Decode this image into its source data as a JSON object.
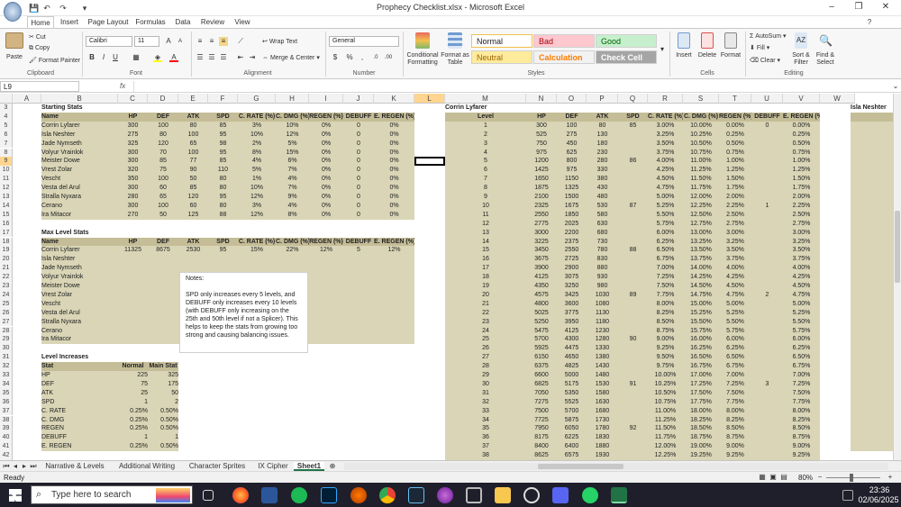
{
  "window": {
    "title": "Prophecy Checklist.xlsx - Microsoft Excel",
    "controls": [
      "–",
      "❐",
      "✕"
    ]
  },
  "ribbon_tabs": [
    "Home",
    "Insert",
    "Page Layout",
    "Formulas",
    "Data",
    "Review",
    "View"
  ],
  "ribbon": {
    "clipboard": {
      "paste": "Paste",
      "cut": "Cut",
      "copy": "Copy",
      "painter": "Format Painter",
      "label": "Clipboard"
    },
    "font": {
      "name": "Calibri",
      "size": "11",
      "label": "Font"
    },
    "alignment": {
      "wrap": "Wrap Text",
      "merge": "Merge & Center",
      "label": "Alignment"
    },
    "number": {
      "format": "General",
      "label": "Number"
    },
    "styles": {
      "cond": "Conditional Formatting",
      "fmt_table": "Format as Table",
      "normal": "Normal",
      "bad": "Bad",
      "good": "Good",
      "neutral": "Neutral",
      "calculation": "Calculation",
      "check": "Check Cell",
      "label": "Styles"
    },
    "cells": {
      "insert": "Insert",
      "delete": "Delete",
      "format": "Format",
      "label": "Cells"
    },
    "editing": {
      "autosum": "AutoSum",
      "fill": "Fill",
      "clear": "Clear",
      "sort": "Sort & Filter",
      "find": "Find & Select",
      "label": "Editing"
    }
  },
  "formula_bar": {
    "name_box": "L9",
    "fx": "fx",
    "value": ""
  },
  "columns": [
    "A",
    "B",
    "C",
    "D",
    "E",
    "F",
    "G",
    "H",
    "I",
    "J",
    "K",
    "L",
    "M",
    "N",
    "O",
    "P",
    "Q",
    "R",
    "S",
    "T",
    "U",
    "V",
    "W"
  ],
  "rows": [
    "3",
    "4",
    "5",
    "6",
    "7",
    "8",
    "9",
    "10",
    "11",
    "12",
    "13",
    "14",
    "15",
    "16",
    "17",
    "18",
    "19",
    "20",
    "21",
    "22",
    "23",
    "24",
    "25",
    "26",
    "27",
    "28",
    "29",
    "30",
    "31",
    "32",
    "33",
    "34",
    "35",
    "36",
    "37",
    "38",
    "39",
    "40",
    "41",
    "42"
  ],
  "starting": {
    "title": "Starting Stats",
    "headers": [
      "Name",
      "HP",
      "DEF",
      "ATK",
      "SPD",
      "C. RATE (%)",
      "C. DMG (%)",
      "REGEN (%)",
      "DEBUFF",
      "E. REGEN (%)"
    ],
    "rows": [
      [
        "Corrin Lyfarer",
        "300",
        "100",
        "80",
        "85",
        "3%",
        "10%",
        "0%",
        "0",
        "0%"
      ],
      [
        "Isla Neshter",
        "275",
        "80",
        "100",
        "95",
        "10%",
        "12%",
        "0%",
        "0",
        "0%"
      ],
      [
        "Jade Nymseth",
        "325",
        "120",
        "65",
        "98",
        "2%",
        "5%",
        "0%",
        "0",
        "0%"
      ],
      [
        "Volyur Vrainlok",
        "300",
        "70",
        "100",
        "95",
        "8%",
        "15%",
        "0%",
        "0",
        "0%"
      ],
      [
        "Meister Dowe",
        "300",
        "85",
        "77",
        "85",
        "4%",
        "6%",
        "0%",
        "0",
        "0%"
      ],
      [
        "Vrest Zolar",
        "320",
        "75",
        "90",
        "110",
        "5%",
        "7%",
        "0%",
        "0",
        "0%"
      ],
      [
        "Vescht",
        "350",
        "100",
        "50",
        "80",
        "1%",
        "4%",
        "0%",
        "0",
        "0%"
      ],
      [
        "Vesta del Arul",
        "300",
        "60",
        "85",
        "80",
        "10%",
        "7%",
        "0%",
        "0",
        "0%"
      ],
      [
        "Stralla Nyxara",
        "280",
        "65",
        "120",
        "95",
        "12%",
        "9%",
        "0%",
        "0",
        "0%"
      ],
      [
        "Cerano",
        "300",
        "100",
        "60",
        "80",
        "3%",
        "4%",
        "0%",
        "0",
        "0%"
      ],
      [
        "Ira Mitacor",
        "270",
        "50",
        "125",
        "88",
        "12%",
        "8%",
        "0%",
        "0",
        "0%"
      ]
    ]
  },
  "max": {
    "title": "Max Level Stats",
    "headers": [
      "Name",
      "HP",
      "DEF",
      "ATK",
      "SPD",
      "C. RATE (%)",
      "C. DMG (%)",
      "REGEN (%)",
      "DEBUFF",
      "E. REGEN (%)"
    ],
    "rows": [
      [
        "Corrin Lyfarer",
        "11325",
        "8675",
        "2530",
        "95",
        "15%",
        "22%",
        "12%",
        "5",
        "12%"
      ],
      [
        "Isla Neshter",
        "",
        "",
        "",
        "",
        "",
        "",
        "",
        "",
        ""
      ],
      [
        "Jade Nymseth",
        "",
        "",
        "",
        "",
        "",
        "",
        "",
        "",
        ""
      ],
      [
        "Volyur Vrainlok",
        "",
        "",
        "",
        "",
        "",
        "",
        "",
        "",
        ""
      ],
      [
        "Meister Dowe",
        "",
        "",
        "",
        "",
        "",
        "",
        "",
        "",
        ""
      ],
      [
        "Vrest Zolar",
        "",
        "",
        "",
        "",
        "",
        "",
        "",
        "",
        ""
      ],
      [
        "Vescht",
        "",
        "",
        "",
        "",
        "",
        "",
        "",
        "",
        ""
      ],
      [
        "Vesta del Arul",
        "",
        "",
        "",
        "",
        "",
        "",
        "",
        "",
        ""
      ],
      [
        "Stralla Nyxara",
        "",
        "",
        "",
        "",
        "",
        "",
        "",
        "",
        ""
      ],
      [
        "Cerano",
        "",
        "",
        "",
        "",
        "",
        "",
        "",
        "",
        ""
      ],
      [
        "Ira Mitacor",
        "",
        "",
        "",
        "",
        "",
        "",
        "",
        "",
        ""
      ]
    ]
  },
  "increases": {
    "title": "Level Increases",
    "headers": [
      "Stat",
      "Normal",
      "Main Stat"
    ],
    "rows": [
      [
        "HP",
        "225",
        "325"
      ],
      [
        "DEF",
        "75",
        "175"
      ],
      [
        "ATK",
        "25",
        "50"
      ],
      [
        "SPD",
        "1",
        "2"
      ],
      [
        "C. RATE",
        "0.25%",
        "0.50%"
      ],
      [
        "C. DMG",
        "0.25%",
        "0.50%"
      ],
      [
        "REGEN",
        "0.25%",
        "0.50%"
      ],
      [
        "DEBUFF",
        "1",
        "1"
      ],
      [
        "E. REGEN",
        "0.25%",
        "0.50%"
      ]
    ]
  },
  "note": "Notes:\n\nSPD only increases every 5 levels, and DEBUFF only increases every 10 levels (with DEBUFF only increasing on the 25th and 50th level if not a Splicer). This helps to keep the stats from growing too strong and causing balancing issues.",
  "corrin": {
    "title": "Corrin Lyfarer",
    "headers": [
      "Level",
      "HP",
      "DEF",
      "ATK",
      "SPD",
      "C. RATE (%)",
      "C. DMG (%)",
      "REGEN (%)",
      "DEBUFF",
      "E. REGEN (%)"
    ],
    "rows": [
      [
        "1",
        "300",
        "100",
        "80",
        "85",
        "3.00%",
        "10.00%",
        "0.00%",
        "0",
        "0.00%"
      ],
      [
        "2",
        "525",
        "275",
        "130",
        "",
        "3.25%",
        "10.25%",
        "0.25%",
        "",
        "0.25%"
      ],
      [
        "3",
        "750",
        "450",
        "180",
        "",
        "3.50%",
        "10.50%",
        "0.50%",
        "",
        "0.50%"
      ],
      [
        "4",
        "975",
        "625",
        "230",
        "",
        "3.75%",
        "10.75%",
        "0.75%",
        "",
        "0.75%"
      ],
      [
        "5",
        "1200",
        "800",
        "280",
        "86",
        "4.00%",
        "11.00%",
        "1.00%",
        "",
        "1.00%"
      ],
      [
        "6",
        "1425",
        "975",
        "330",
        "",
        "4.25%",
        "11.25%",
        "1.25%",
        "",
        "1.25%"
      ],
      [
        "7",
        "1650",
        "1150",
        "380",
        "",
        "4.50%",
        "11.50%",
        "1.50%",
        "",
        "1.50%"
      ],
      [
        "8",
        "1875",
        "1325",
        "430",
        "",
        "4.75%",
        "11.75%",
        "1.75%",
        "",
        "1.75%"
      ],
      [
        "9",
        "2100",
        "1500",
        "480",
        "",
        "5.00%",
        "12.00%",
        "2.00%",
        "",
        "2.00%"
      ],
      [
        "10",
        "2325",
        "1675",
        "530",
        "87",
        "5.25%",
        "12.25%",
        "2.25%",
        "1",
        "2.25%"
      ],
      [
        "11",
        "2550",
        "1850",
        "580",
        "",
        "5.50%",
        "12.50%",
        "2.50%",
        "",
        "2.50%"
      ],
      [
        "12",
        "2775",
        "2025",
        "630",
        "",
        "5.75%",
        "12.75%",
        "2.75%",
        "",
        "2.75%"
      ],
      [
        "13",
        "3000",
        "2200",
        "680",
        "",
        "6.00%",
        "13.00%",
        "3.00%",
        "",
        "3.00%"
      ],
      [
        "14",
        "3225",
        "2375",
        "730",
        "",
        "6.25%",
        "13.25%",
        "3.25%",
        "",
        "3.25%"
      ],
      [
        "15",
        "3450",
        "2550",
        "780",
        "88",
        "6.50%",
        "13.50%",
        "3.50%",
        "",
        "3.50%"
      ],
      [
        "16",
        "3675",
        "2725",
        "830",
        "",
        "6.75%",
        "13.75%",
        "3.75%",
        "",
        "3.75%"
      ],
      [
        "17",
        "3900",
        "2900",
        "880",
        "",
        "7.00%",
        "14.00%",
        "4.00%",
        "",
        "4.00%"
      ],
      [
        "18",
        "4125",
        "3075",
        "930",
        "",
        "7.25%",
        "14.25%",
        "4.25%",
        "",
        "4.25%"
      ],
      [
        "19",
        "4350",
        "3250",
        "980",
        "",
        "7.50%",
        "14.50%",
        "4.50%",
        "",
        "4.50%"
      ],
      [
        "20",
        "4575",
        "3425",
        "1030",
        "89",
        "7.75%",
        "14.75%",
        "4.75%",
        "2",
        "4.75%"
      ],
      [
        "21",
        "4800",
        "3600",
        "1080",
        "",
        "8.00%",
        "15.00%",
        "5.00%",
        "",
        "5.00%"
      ],
      [
        "22",
        "5025",
        "3775",
        "1130",
        "",
        "8.25%",
        "15.25%",
        "5.25%",
        "",
        "5.25%"
      ],
      [
        "23",
        "5250",
        "3950",
        "1180",
        "",
        "8.50%",
        "15.50%",
        "5.50%",
        "",
        "5.50%"
      ],
      [
        "24",
        "5475",
        "4125",
        "1230",
        "",
        "8.75%",
        "15.75%",
        "5.75%",
        "",
        "5.75%"
      ],
      [
        "25",
        "5700",
        "4300",
        "1280",
        "90",
        "9.00%",
        "16.00%",
        "6.00%",
        "",
        "6.00%"
      ],
      [
        "26",
        "5925",
        "4475",
        "1330",
        "",
        "9.25%",
        "16.25%",
        "6.25%",
        "",
        "6.25%"
      ],
      [
        "27",
        "6150",
        "4650",
        "1380",
        "",
        "9.50%",
        "16.50%",
        "6.50%",
        "",
        "6.50%"
      ],
      [
        "28",
        "6375",
        "4825",
        "1430",
        "",
        "9.75%",
        "16.75%",
        "6.75%",
        "",
        "6.75%"
      ],
      [
        "29",
        "6600",
        "5000",
        "1480",
        "",
        "10.00%",
        "17.00%",
        "7.00%",
        "",
        "7.00%"
      ],
      [
        "30",
        "6825",
        "5175",
        "1530",
        "91",
        "10.25%",
        "17.25%",
        "7.25%",
        "3",
        "7.25%"
      ],
      [
        "31",
        "7050",
        "5350",
        "1580",
        "",
        "10.50%",
        "17.50%",
        "7.50%",
        "",
        "7.50%"
      ],
      [
        "32",
        "7275",
        "5525",
        "1630",
        "",
        "10.75%",
        "17.75%",
        "7.75%",
        "",
        "7.75%"
      ],
      [
        "33",
        "7500",
        "5700",
        "1680",
        "",
        "11.00%",
        "18.00%",
        "8.00%",
        "",
        "8.00%"
      ],
      [
        "34",
        "7725",
        "5875",
        "1730",
        "",
        "11.25%",
        "18.25%",
        "8.25%",
        "",
        "8.25%"
      ],
      [
        "35",
        "7950",
        "6050",
        "1780",
        "92",
        "11.50%",
        "18.50%",
        "8.50%",
        "",
        "8.50%"
      ],
      [
        "36",
        "8175",
        "6225",
        "1830",
        "",
        "11.75%",
        "18.75%",
        "8.75%",
        "",
        "8.75%"
      ],
      [
        "37",
        "8400",
        "6400",
        "1880",
        "",
        "12.00%",
        "19.00%",
        "9.00%",
        "",
        "9.00%"
      ],
      [
        "38",
        "8625",
        "6575",
        "1930",
        "",
        "12.25%",
        "19.25%",
        "9.25%",
        "",
        "9.25%"
      ]
    ]
  },
  "isla_title": "Isla Neshter",
  "sheets": [
    "Narrative & Levels",
    "Additional Writing",
    "Character Sprites",
    "IX Cipher",
    "Sheet1"
  ],
  "active_sheet": "Sheet1",
  "status": {
    "left": "Ready",
    "zoom": "80%"
  },
  "taskbar": {
    "search": "Type here to search",
    "time": "23:36",
    "date": "02/06/2025"
  }
}
